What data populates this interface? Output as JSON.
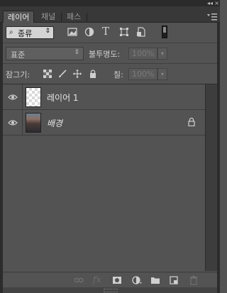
{
  "window": {
    "collapse_glyph": "◂◂",
    "close_glyph": "×"
  },
  "tabs": [
    {
      "label": "레이어",
      "active": true
    },
    {
      "label": "채널",
      "active": false
    },
    {
      "label": "패스",
      "active": false
    }
  ],
  "panel_menu_icon": "panel-menu-icon",
  "filter": {
    "search_glyph": "⌕",
    "label": "종류",
    "arrow": "⇕",
    "icons": [
      "image-filter-icon",
      "adjustment-filter-icon",
      "type-filter-icon",
      "shape-filter-icon",
      "smart-object-filter-icon"
    ],
    "type_glyph": "T"
  },
  "blend": {
    "mode": "표준",
    "arrow": "⇕",
    "opacity_label": "불투명도:",
    "opacity_value": "100%"
  },
  "lock": {
    "label": "잠그기:",
    "icons": [
      "lock-transparent-icon",
      "lock-image-icon",
      "lock-position-icon",
      "lock-all-icon"
    ],
    "fill_label": "칠:",
    "fill_value": "100%"
  },
  "layers": [
    {
      "name": "레이어 1",
      "visible": true,
      "thumbnail": "transparent",
      "locked": false,
      "italic": false
    },
    {
      "name": "배경",
      "visible": true,
      "thumbnail": "photo",
      "locked": true,
      "italic": true
    }
  ],
  "bottom_icons": [
    "link-layers-icon",
    "fx-icon",
    "add-mask-icon",
    "new-adjustment-layer-icon",
    "new-group-icon",
    "new-layer-icon",
    "delete-layer-icon"
  ],
  "fx_glyph": "fx",
  "dropdown_arrow": "▾",
  "colors": {
    "panel_bg": "#535353",
    "tab_bar": "#383838",
    "dark_border": "#2c2c2c"
  }
}
